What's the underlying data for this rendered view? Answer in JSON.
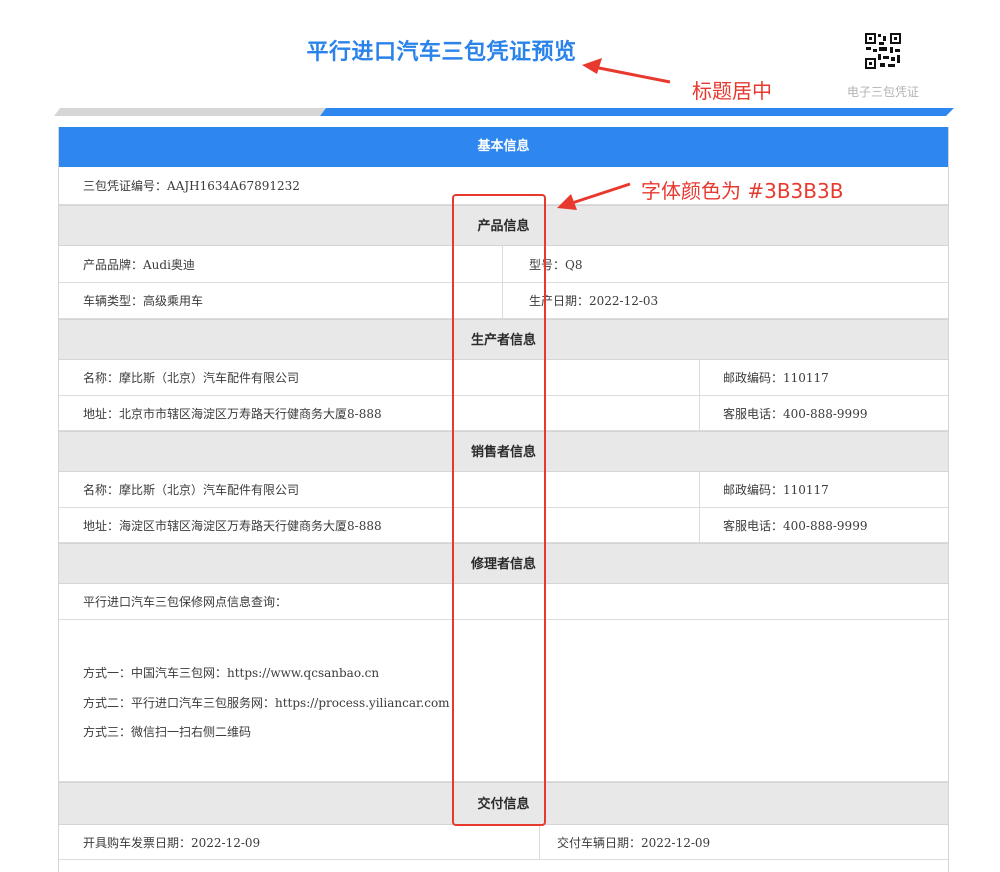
{
  "header": {
    "title": "平行进口汽车三包凭证预览",
    "qr_caption": "电子三包凭证"
  },
  "sections": {
    "basic": "基本信息",
    "product": "产品信息",
    "producer": "生产者信息",
    "seller": "销售者信息",
    "repairer": "修理者信息",
    "delivery": "交付信息"
  },
  "basic": {
    "cert_no": "三包凭证编号：AAJH1634A67891232"
  },
  "product": {
    "brand": "产品品牌：Audi奥迪",
    "model": "型号：Q8",
    "vehicle_type": "车辆类型：高级乘用车",
    "production_date": "生产日期：2022-12-03"
  },
  "producer": {
    "name": "名称：摩比斯（北京）汽车配件有限公司",
    "postal_code": "邮政编码：110117",
    "address": "地址：北京市市辖区海淀区万寿路天行健商务大厦8-888",
    "phone": "客服电话：400-888-9999"
  },
  "seller": {
    "name": "名称：摩比斯（北京）汽车配件有限公司",
    "postal_code": "邮政编码：110117",
    "address": "地址：海淀区市辖区海淀区万寿路天行健商务大厦8-888",
    "phone": "客服电话：400-888-9999"
  },
  "repairer": {
    "query_label": "平行进口汽车三包保修网点信息查询：",
    "methods": [
      "方式一：中国汽车三包网：https://www.qcsanbao.cn",
      "方式二：平行进口汽车三包服务网：https://process.yiliancar.com",
      "方式三：微信扫一扫右侧二维码"
    ]
  },
  "delivery": {
    "invoice_date": "开具购车发票日期：2022-12-09",
    "delivery_date": "交付车辆日期：2022-12-09"
  },
  "annotations": {
    "title_note": "标题居中",
    "font_note": "字体颜色为 #3B3B3B"
  },
  "colors": {
    "title_blue": "#2a83ea",
    "band_blue": "#2d87ef",
    "band_grey": "#e8e8e8",
    "text": "#3B3B3B",
    "annotation_red": "#e8392f"
  }
}
